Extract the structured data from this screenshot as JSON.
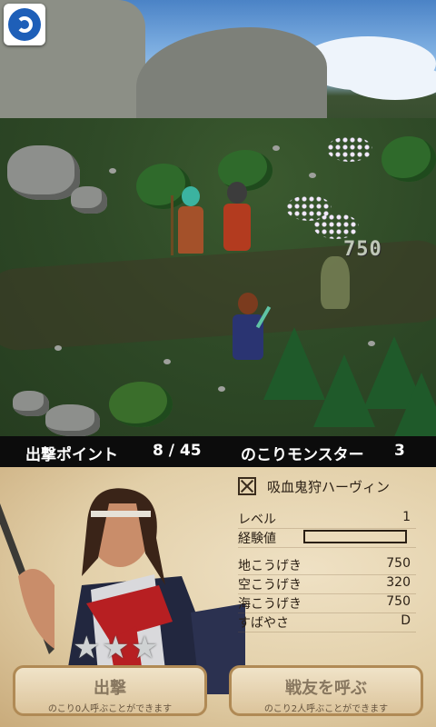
{
  "status": {
    "points_label": "出撃ポイント",
    "points_value": "8 / 45",
    "remaining_label": "のこりモンスター",
    "remaining_value": "3"
  },
  "battle": {
    "damage_text": "750"
  },
  "unit": {
    "name": "吸血鬼狩ハーヴィン",
    "stats": [
      {
        "label": "レベル",
        "value": "1"
      },
      {
        "label": "経験値",
        "value": ""
      },
      {
        "label": "地こうげき",
        "value": "750"
      },
      {
        "label": "空こうげき",
        "value": "320"
      },
      {
        "label": "海こうげき",
        "value": "750"
      },
      {
        "label": "すばやさ",
        "value": "D"
      }
    ],
    "stars": 3
  },
  "buttons": {
    "sortie": {
      "label": "出撃",
      "sub": "のこり0人呼ぶことができます"
    },
    "call_ally": {
      "label": "戦友を呼ぶ",
      "sub": "のこり2人呼ぶことができます"
    }
  },
  "colors": {
    "accent": "#1e5fb8",
    "bar_bg": "#0c0c0c",
    "panel": "#e2cfa8"
  }
}
